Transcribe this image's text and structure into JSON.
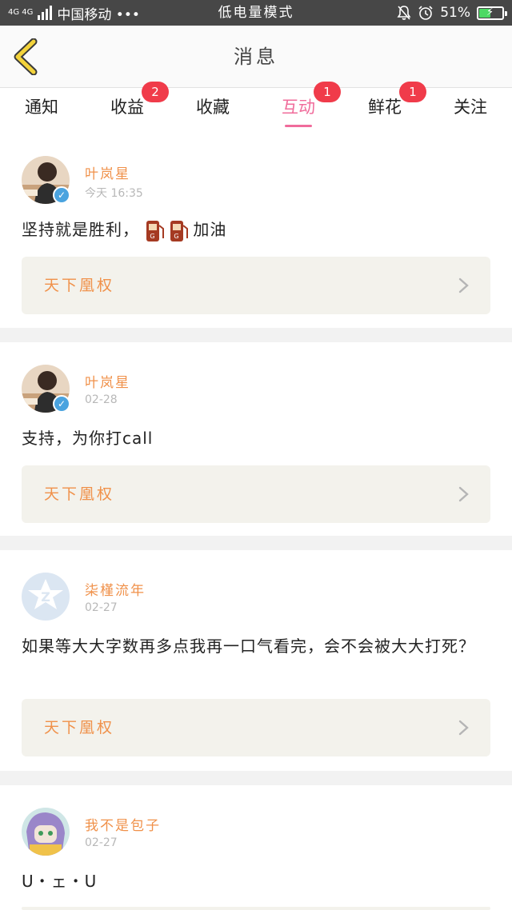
{
  "status_bar": {
    "network": "4G 4G",
    "carrier": "中国移动 •••",
    "mode": "低电量模式",
    "battery": "51%",
    "battery_level": 0.51,
    "battery_color": "#4cd964"
  },
  "header": {
    "title": "消息",
    "back_icon": "chevron-left-icon",
    "accent": "#f3d33b"
  },
  "tabs": [
    {
      "label": "通知",
      "badge": ""
    },
    {
      "label": "收益",
      "badge": "2"
    },
    {
      "label": "收藏",
      "badge": ""
    },
    {
      "label": "互动",
      "badge": "1",
      "active": true
    },
    {
      "label": "鲜花",
      "badge": "1"
    },
    {
      "label": "关注",
      "badge": ""
    }
  ],
  "messages": [
    {
      "user": "叶岚星",
      "time": "今天 16:35",
      "verified": true,
      "content_prefix": "坚持就是胜利，",
      "content_suffix": "加油",
      "inline_icons": [
        "gas-pump-icon",
        "gas-pump-icon"
      ],
      "source": "天下凰权"
    },
    {
      "user": "叶岚星",
      "time": "02-28",
      "verified": true,
      "content": "支持，为你打call",
      "source": "天下凰权"
    },
    {
      "user": "柒槿流年",
      "time": "02-27",
      "verified": false,
      "content": "如果等大大字数再多点我再一口气看完，会不会被大大打死？",
      "source": "天下凰权"
    },
    {
      "user": "我不是包子",
      "time": "02-27",
      "verified": false,
      "content": "U・ェ・U",
      "source": ""
    }
  ],
  "colors": {
    "tab_active": "#f06c9b",
    "badge": "#f03b4a",
    "username": "#f0914a",
    "source_bg": "#f3f2ec"
  }
}
